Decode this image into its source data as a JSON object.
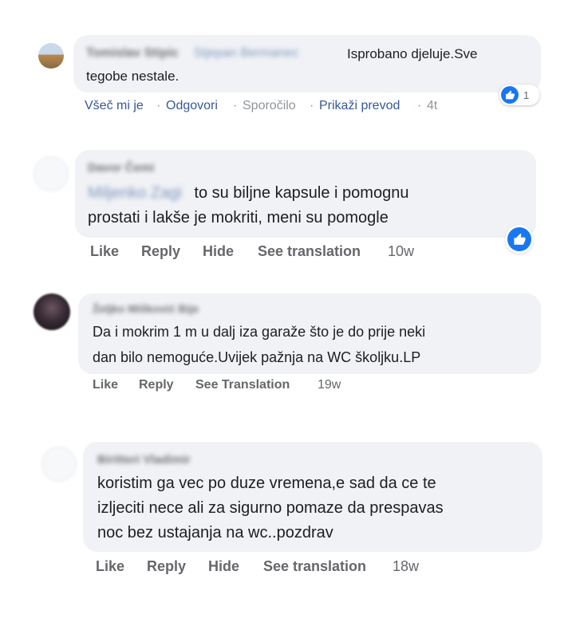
{
  "comments": [
    {
      "author": "Tomislav Stipic",
      "mention": "Stjepan Bermanec",
      "lines": [
        "Isprobano djeluje.Sve",
        "tegobe nestale."
      ],
      "actions": [
        "Všeč mi je",
        "Odgovori",
        "Sporočilo",
        "Prikaži prevod",
        "4t"
      ],
      "reaction_count": "1"
    },
    {
      "author": "Davor Čemi",
      "mention": "Miljenko Zagi",
      "lines": [
        "to su biljne kapsule i pomognu",
        "prostati i lakše je mokriti, meni su pomogle"
      ],
      "actions": [
        "Like",
        "Reply",
        "Hide",
        "See translation",
        "10w"
      ]
    },
    {
      "author": "Željko Mišković Bije",
      "lines": [
        "Da i mokrim 1 m u dalj iza garaže što je do prije neki",
        "dan bilo nemoguće.Uvijek pažnja na WC školjku.LP"
      ],
      "actions": [
        "Like",
        "Reply",
        "See Translation",
        "19w"
      ]
    },
    {
      "author": "Biritteri Vladimir",
      "lines": [
        "koristim ga vec po duze vremena,e sad da ce te",
        "izljeciti nece ali za sigurno pomaze da prespavas",
        "noc bez ustajanja na wc..pozdrav"
      ],
      "actions": [
        "Like",
        "Reply",
        "Hide",
        "See translation",
        "18w"
      ]
    }
  ],
  "colors": {
    "bubble": "#f0f2f5",
    "like_blue": "#1877f2",
    "link_blue": "#385898",
    "meta_gray": "#65676b"
  },
  "icons": [
    "avatar",
    "like-icon"
  ]
}
